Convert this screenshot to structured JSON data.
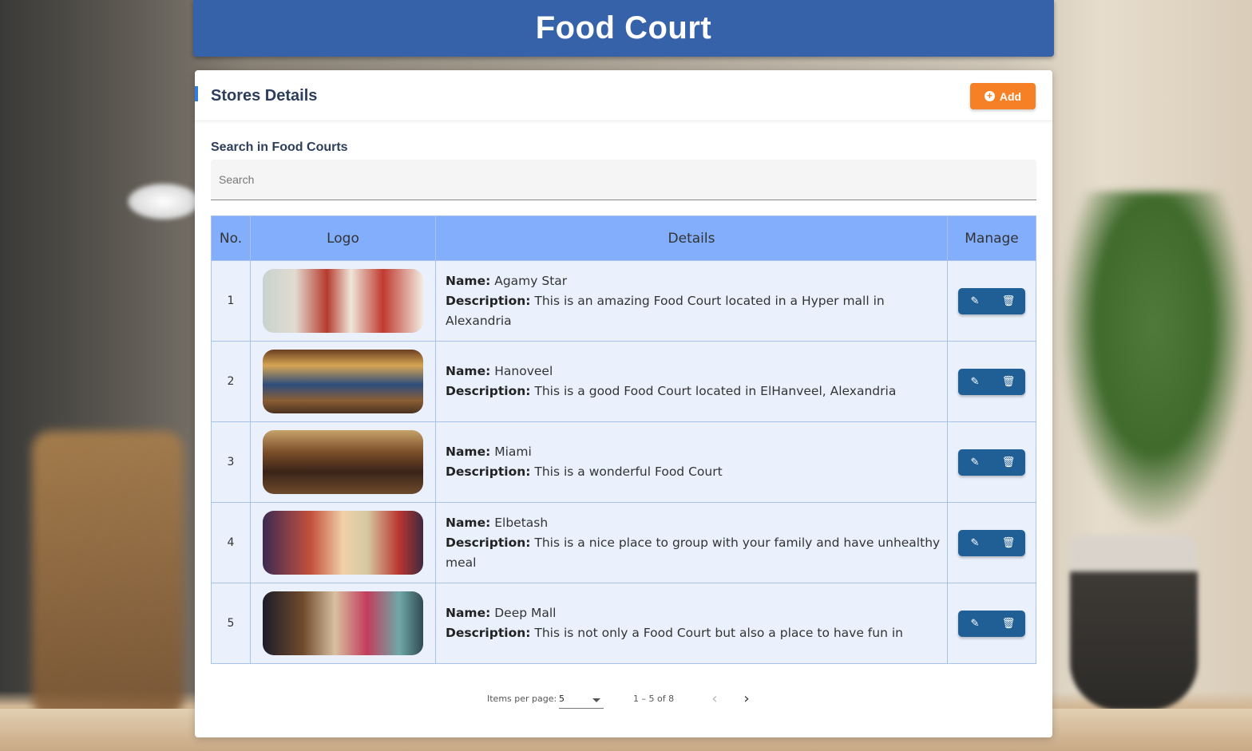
{
  "app_title": "Food Court",
  "card": {
    "title": "Stores Details",
    "add_label": "Add",
    "add_icon": "plus-circle-icon"
  },
  "search": {
    "label": "Search in Food Courts",
    "placeholder": "Search",
    "value": ""
  },
  "table": {
    "headers": [
      "No.",
      "Logo",
      "Details",
      "Manage"
    ],
    "name_label": "Name:",
    "description_label": "Description:",
    "rows": [
      {
        "no": "1",
        "name": "Agamy Star",
        "description": "This is an amazing Food Court located in a Hyper mall in Alexandria"
      },
      {
        "no": "2",
        "name": "Hanoveel",
        "description": "This is a good Food Court located in ElHanveel, Alexandria"
      },
      {
        "no": "3",
        "name": "Miami",
        "description": "This is a wonderful Food Court"
      },
      {
        "no": "4",
        "name": "Elbetash",
        "description": "This is a nice place to group with your family and have unhealthy meal"
      },
      {
        "no": "5",
        "name": "Deep Mall",
        "description": "This is not only a Food Court but also a place to have fun in"
      }
    ],
    "edit_icon": "pencil-icon",
    "delete_icon": "trash-icon"
  },
  "paginator": {
    "items_per_page_label": "Items per page:",
    "items_per_page_value": "5",
    "range_label": "1 – 5 of 8"
  },
  "colors": {
    "banner": "#3562a9",
    "add_button": "#f58025",
    "table_header": "#82aefb",
    "table_row": "#eaf1fd",
    "manage_button": "#1f5f96",
    "title_text": "#2c3e5c"
  }
}
